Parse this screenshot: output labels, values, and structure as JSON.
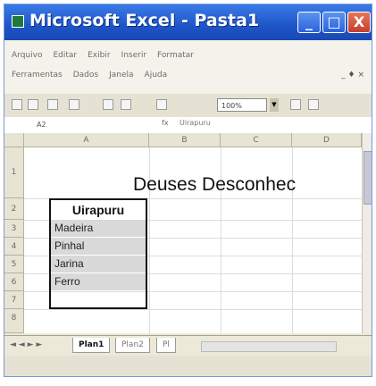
{
  "window": {
    "title": "Microsoft Excel - Pasta1",
    "minimize_glyph": "_",
    "maximize_glyph": "□",
    "close_glyph": "X"
  },
  "menu": {
    "row1": [
      "Arquivo",
      "Editar",
      "Exibir",
      "Inserir",
      "Formatar"
    ],
    "row2": [
      "Ferramentas",
      "Dados",
      "Janela",
      "Ajuda"
    ],
    "close_glyph": "_ ♦ ×"
  },
  "toolbar": {
    "zoom": "100%"
  },
  "formula_bar": {
    "name_box": "A2",
    "fx": "fx",
    "content": "Uirapuru"
  },
  "sheet": {
    "columns": [
      "A",
      "B",
      "C",
      "D"
    ],
    "rows": [
      "1",
      "2",
      "3",
      "4",
      "5",
      "6",
      "7",
      "8"
    ],
    "title": "Deuses Desconhec",
    "header": "Uirapuru",
    "items": [
      "Madeira",
      "Pinhal",
      "Jarina",
      "Ferro"
    ]
  },
  "tabs": {
    "nav": "◄ ◄ ► ►",
    "active": "Plan1",
    "others": [
      "Plan2",
      "Pl"
    ]
  },
  "colors": {
    "title_bar": "#1f55c8",
    "selection_fill": "#d9d9d9",
    "chrome": "#ece9d8"
  }
}
